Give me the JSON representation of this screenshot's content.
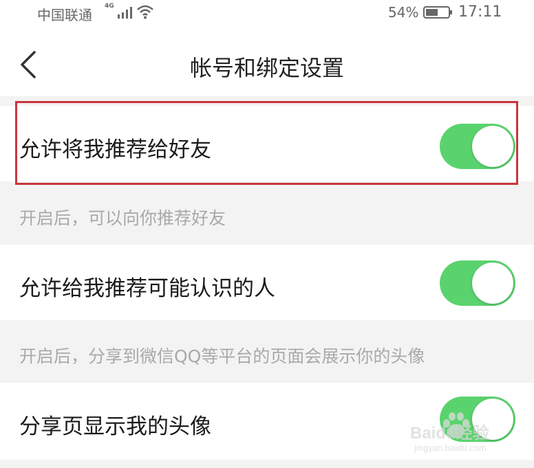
{
  "status_bar": {
    "carrier": "中国联通",
    "network_type": "4G",
    "battery_percent": "54%",
    "time": "17:11",
    "icons": [
      "signal-icon",
      "wifi-icon",
      "battery-icon"
    ]
  },
  "header": {
    "back_icon": "chevron-left-icon",
    "title": "帐号和绑定设置"
  },
  "settings": [
    {
      "label": "允许将我推荐给好友",
      "enabled": true,
      "hint": "开启后，可以向你推荐好友"
    },
    {
      "label": "允许给我推荐可能认识的人",
      "enabled": true,
      "hint": "开启后，分享到微信QQ等平台的页面会展示你的头像"
    },
    {
      "label": "分享页显示我的头像",
      "enabled": true
    }
  ],
  "colors": {
    "toggle_on": "#5ad36e",
    "highlight": "#c8353f",
    "background": "#f3f3f3"
  },
  "watermark": {
    "brand": "Baidu经验",
    "url": "jingyan.baidu.com"
  }
}
